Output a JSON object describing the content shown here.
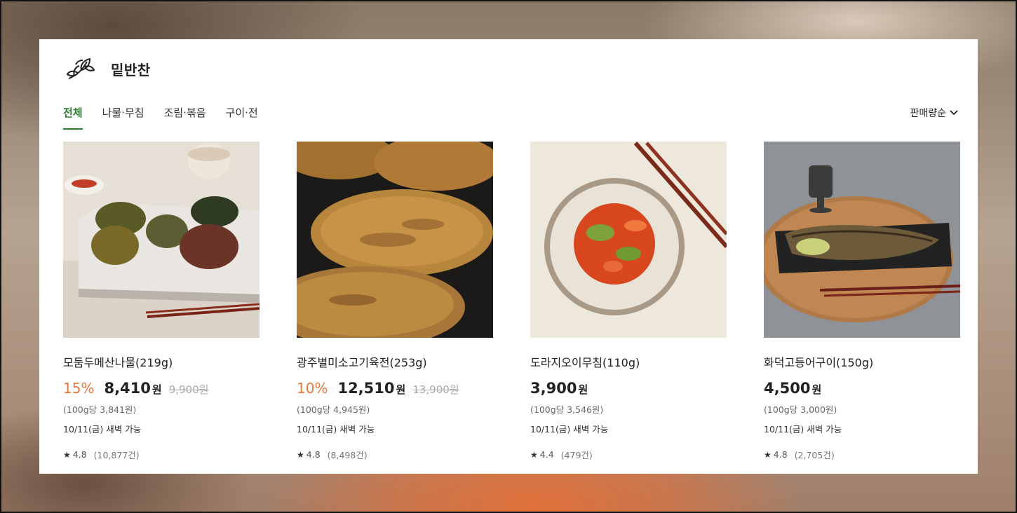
{
  "section": {
    "icon": "leaf-sprig-icon",
    "title": "밑반찬"
  },
  "tabs": [
    {
      "label": "전체",
      "active": true
    },
    {
      "label": "나물·무침",
      "active": false
    },
    {
      "label": "조림·볶음",
      "active": false
    },
    {
      "label": "구이·전",
      "active": false
    }
  ],
  "sort": {
    "label": "판매량순",
    "icon": "chevron-down-icon"
  },
  "products": [
    {
      "name": "모둠두메산나물(219g)",
      "discount": "15%",
      "price": "8,410",
      "currency": "원",
      "original_price": "9,900원",
      "unit_price": "(100g당 3,841원)",
      "delivery": "10/11(금) 새벽 가능",
      "rating": "4.8",
      "reviews": "(10,877건)"
    },
    {
      "name": "광주별미소고기육전(253g)",
      "discount": "10%",
      "price": "12,510",
      "currency": "원",
      "original_price": "13,900원",
      "unit_price": "(100g당 4,945원)",
      "delivery": "10/11(금) 새벽 가능",
      "rating": "4.8",
      "reviews": "(8,498건)"
    },
    {
      "name": "도라지오이무침(110g)",
      "discount": "",
      "price": "3,900",
      "currency": "원",
      "original_price": "",
      "unit_price": "(100g당 3,546원)",
      "delivery": "10/11(금) 새벽 가능",
      "rating": "4.4",
      "reviews": "(479건)"
    },
    {
      "name": "화덕고등어구이(150g)",
      "discount": "",
      "price": "4,500",
      "currency": "원",
      "original_price": "",
      "unit_price": "(100g당 3,000원)",
      "delivery": "10/11(금) 새벽 가능",
      "rating": "4.8",
      "reviews": "(2,705건)"
    }
  ],
  "colors": {
    "accent_green": "#2f7d32",
    "discount_orange": "#e8773a"
  }
}
